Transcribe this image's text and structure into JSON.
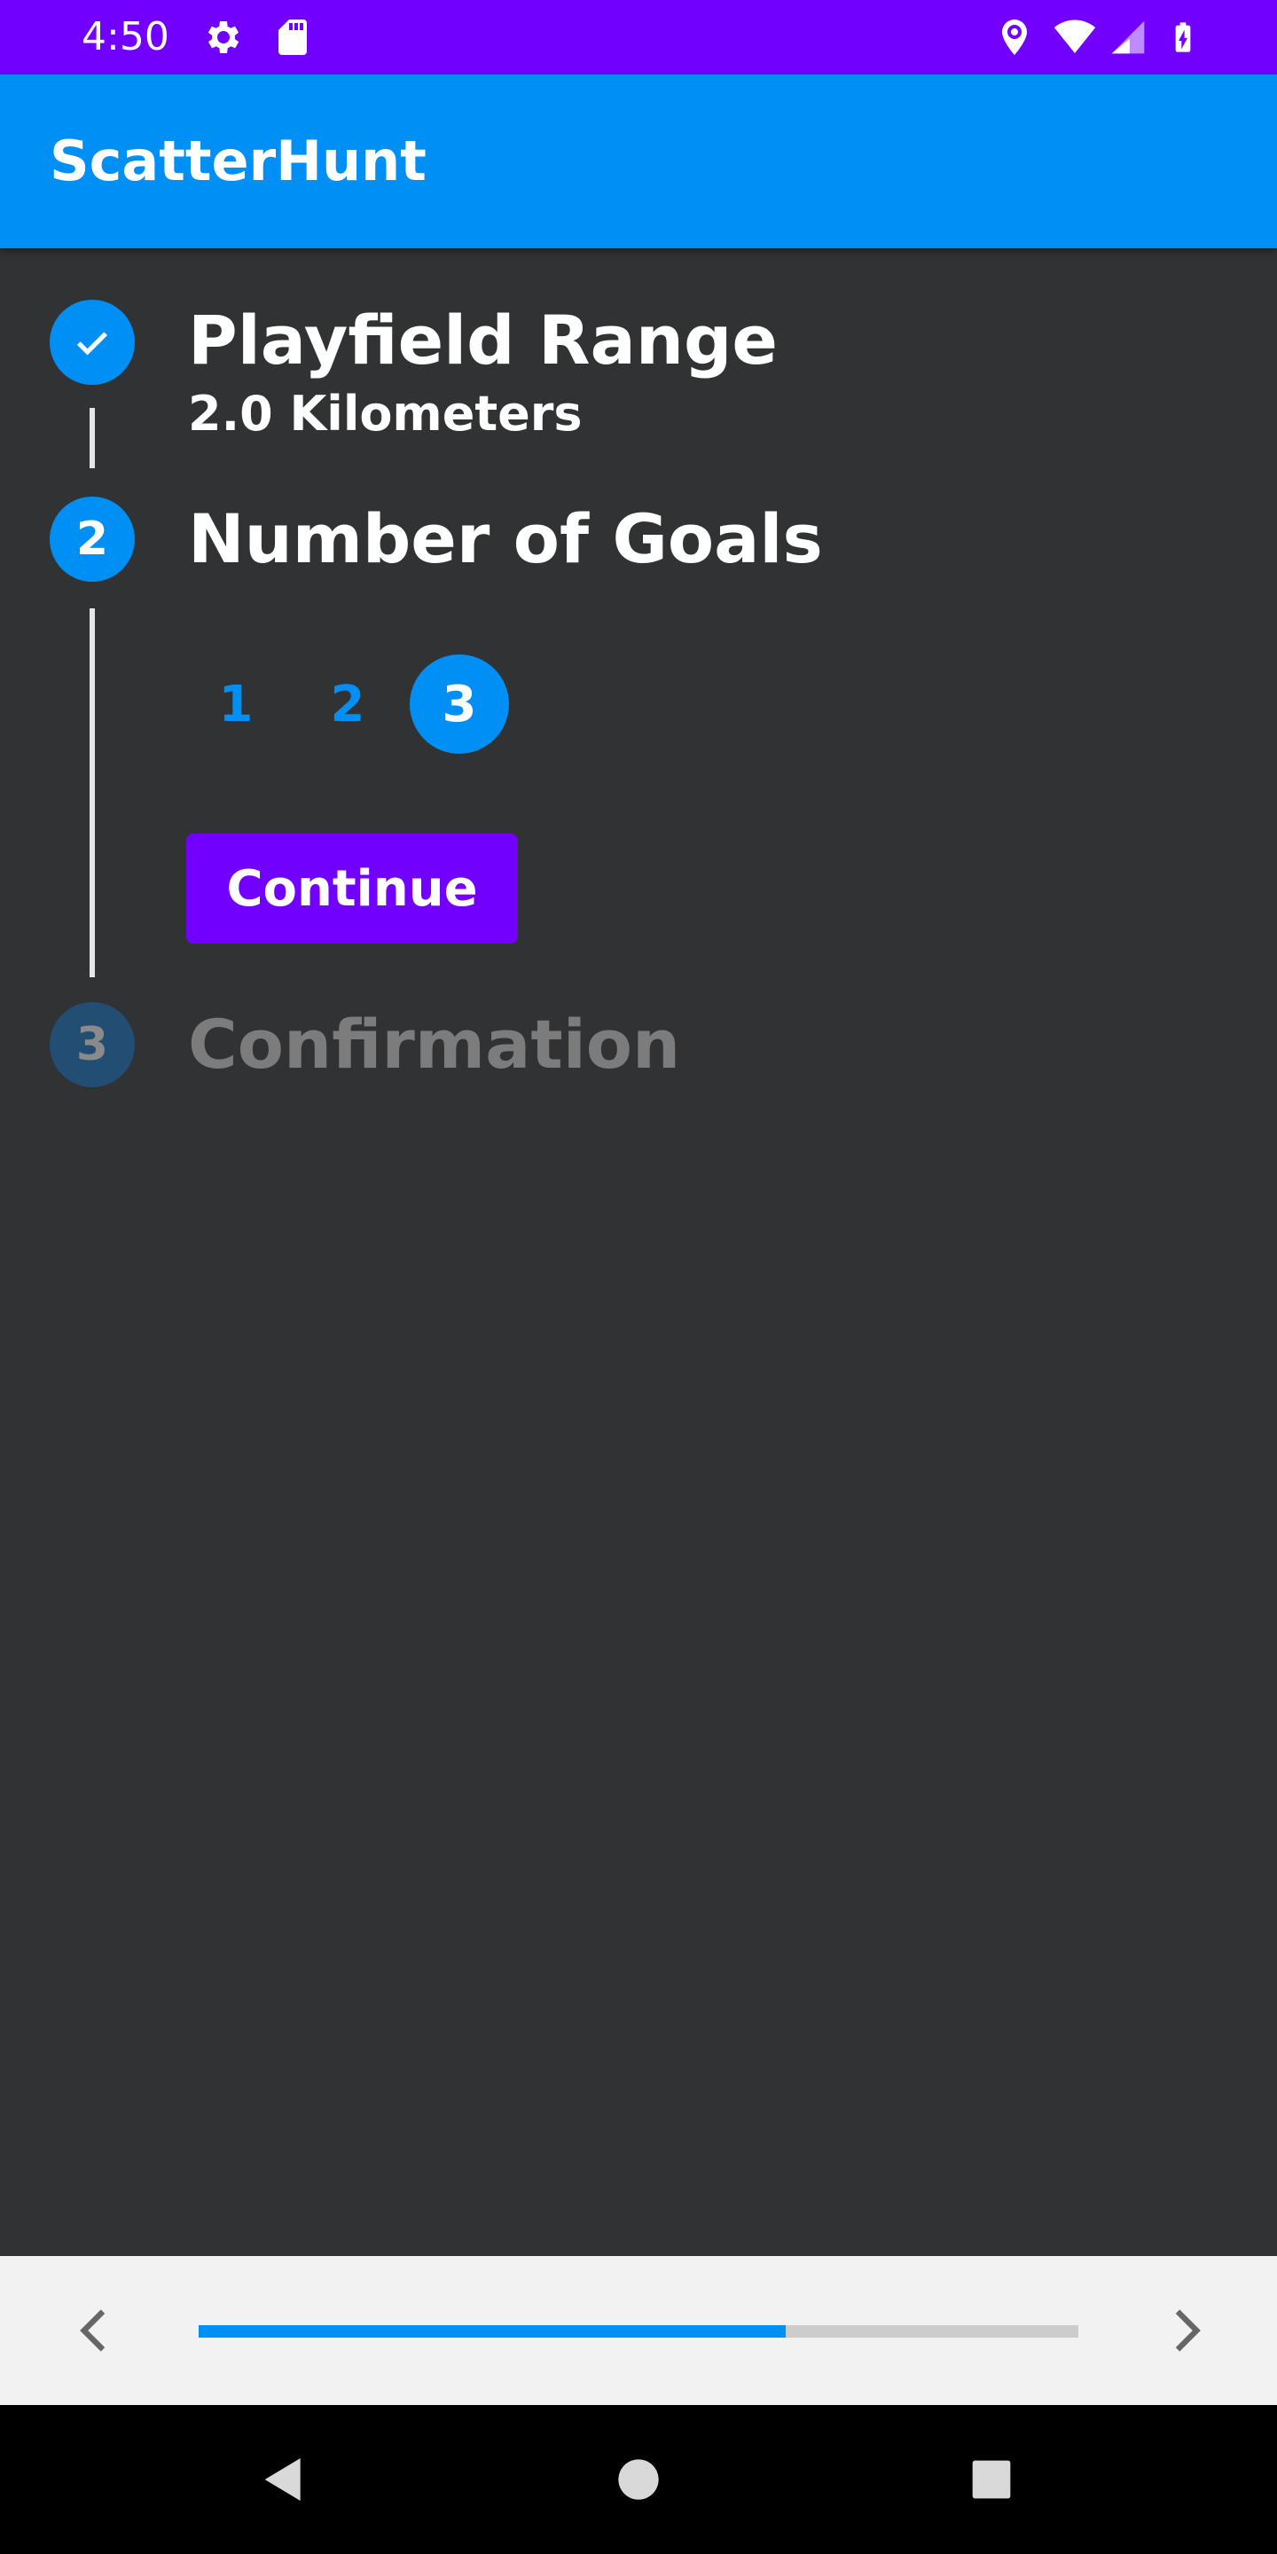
{
  "status_bar": {
    "time": "4:50",
    "icons": [
      "gear-icon",
      "sd-card-icon",
      "location-icon",
      "wifi-icon",
      "signal-icon",
      "battery-charging-icon"
    ]
  },
  "app_bar": {
    "title": "ScatterHunt"
  },
  "stepper": {
    "steps": [
      {
        "number": "1",
        "title": "Playfield Range",
        "subtitle": "2.0 Kilometers",
        "state": "completed",
        "icon": "check-icon"
      },
      {
        "number": "2",
        "title": "Number of Goals",
        "state": "active"
      },
      {
        "number": "3",
        "title": "Confirmation",
        "state": "disabled"
      }
    ],
    "goal_options": [
      "1",
      "2",
      "3"
    ],
    "selected_goal": "3",
    "continue_label": "Continue"
  },
  "bottom_bar": {
    "progress": 0.667,
    "prev_icon": "chevron-left-icon",
    "next_icon": "chevron-right-icon"
  },
  "system_nav": {
    "icons": [
      "back-icon",
      "home-icon",
      "recents-icon"
    ]
  },
  "colors": {
    "status_bar": "#7200FF",
    "app_bar": "#0090F5",
    "accent": "#0090F5",
    "button": "#7200FF",
    "background": "#313234"
  }
}
